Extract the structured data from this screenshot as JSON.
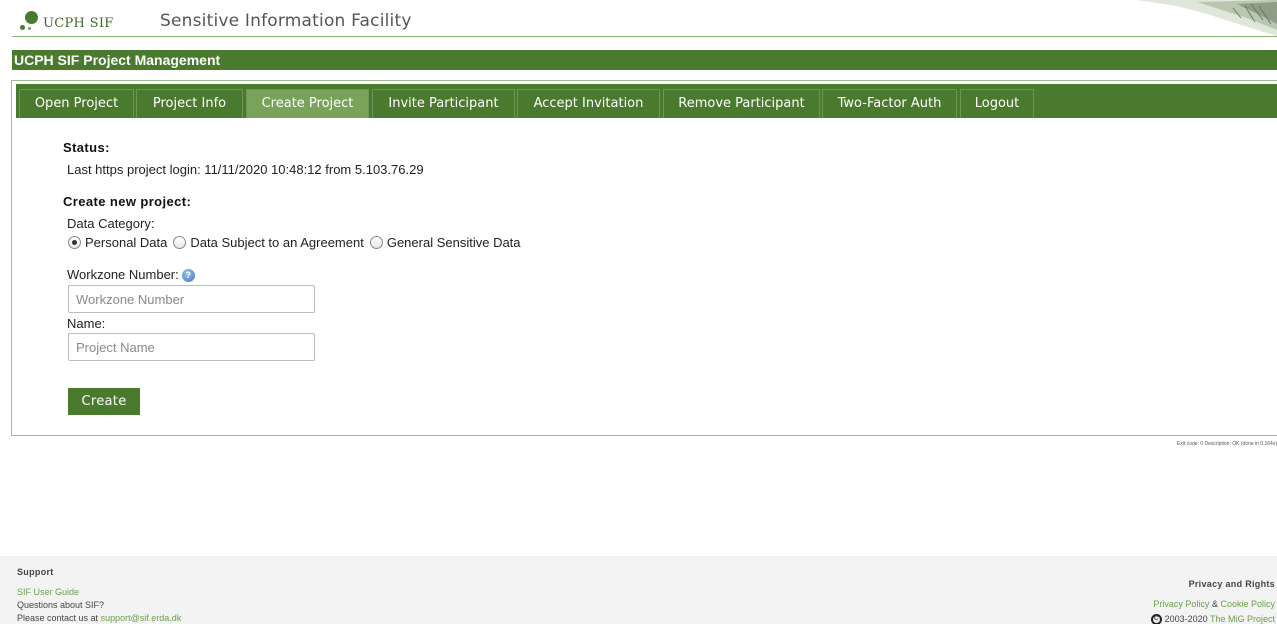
{
  "header": {
    "logo_text": "UCPH SIF",
    "site_title": "Sensitive Information Facility"
  },
  "page": {
    "title": "UCPH SIF Project Management"
  },
  "tabs": [
    {
      "label": "Open Project",
      "active": false
    },
    {
      "label": "Project Info",
      "active": false
    },
    {
      "label": "Create Project",
      "active": true
    },
    {
      "label": "Invite Participant",
      "active": false
    },
    {
      "label": "Accept Invitation",
      "active": false
    },
    {
      "label": "Remove Participant",
      "active": false
    },
    {
      "label": "Two-Factor Auth",
      "active": false
    },
    {
      "label": "Logout",
      "active": false
    }
  ],
  "status": {
    "heading": "Status:",
    "text": "Last https project login: 11/11/2020 10:48:12 from 5.103.76.29"
  },
  "create": {
    "heading": "Create new project:",
    "category_label": "Data Category:",
    "categories": [
      {
        "label": "Personal Data",
        "checked": true
      },
      {
        "label": "Data Subject to an Agreement",
        "checked": false
      },
      {
        "label": "General Sensitive Data",
        "checked": false
      }
    ],
    "workzone_label": "Workzone Number:",
    "workzone_placeholder": "Workzone Number",
    "workzone_value": "",
    "name_label": "Name:",
    "name_placeholder": "Project Name",
    "name_value": "",
    "button_label": "Create"
  },
  "exit_code": "Exit code: 0 Description: OK (done in 0.164s)",
  "footer": {
    "support_heading": "Support",
    "user_guide_link": "SIF User Guide",
    "questions": "Questions about SIF?",
    "contact_prefix": "Please contact us at",
    "contact_email": "support@sif.erda.dk",
    "privacy_heading": "Privacy and Rights",
    "privacy_link": "Privacy Policy",
    "and_text": "&",
    "cookie_link": "Cookie Policy",
    "copyright_years": "2003-2020",
    "mig_link": "The MiG Project"
  },
  "colors": {
    "brand_green": "#4a7a2e",
    "active_tab": "#7aa35a",
    "link_green": "#6aa04c"
  }
}
